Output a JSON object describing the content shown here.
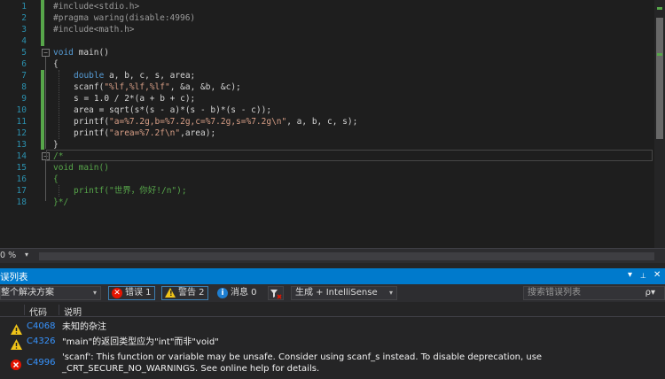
{
  "editor": {
    "line_numbers": [
      "1",
      "2",
      "3",
      "4",
      "5",
      "6",
      "7",
      "8",
      "9",
      "10",
      "11",
      "12",
      "13",
      "14",
      "15",
      "16",
      "17",
      "18"
    ]
  },
  "code": {
    "l1": "#include<stdio.h>",
    "l2": "#pragma waring(disable:4996)",
    "l3": "#include<math.h>",
    "l5_kw": "void",
    "l5_rest": " main()",
    "l6": "{",
    "l7_kw": "double",
    "l7_rest": " a, b, c, s, area;",
    "l8_a": "scanf(",
    "l8_str": "\"%lf,%lf,%lf\"",
    "l8_b": ", &a, &b, &c);",
    "l9": "s = 1.0 / 2*(a + b + c);",
    "l10": "area = sqrt(s*(s - a)*(s - b)*(s - c));",
    "l11_a": "printf(",
    "l11_str": "\"a=%7.2g,b=%7.2g,c=%7.2g,s=%7.2g\\n\"",
    "l11_b": ", a, b, c, s);",
    "l12_a": "printf(",
    "l12_str": "\"area=%7.2f\\n\"",
    "l12_b": ",area);",
    "l13": "}",
    "l14": "/*",
    "l15": "void main()",
    "l16": "{",
    "l17": "printf(\"世界，你好!/n\");",
    "l18": "}*/"
  },
  "zoom": {
    "value": "0 %"
  },
  "panel": {
    "title": "误列表",
    "title_icons": [
      "▾",
      "📌",
      "✕"
    ],
    "scope": "整个解决方案",
    "errors_label": "错误 1",
    "warnings_label": "警告 2",
    "messages_label": "消息 0",
    "build_label": "生成 + IntelliSense",
    "search_placeholder": "搜索错误列表",
    "search_icon": "ρ▾",
    "col_code": "代码",
    "col_desc": "说明",
    "rows": [
      {
        "severity": "warning",
        "code": "C4068",
        "desc": "未知的杂注"
      },
      {
        "severity": "warning",
        "code": "C4326",
        "desc": "\"main\"的返回类型应为\"int\"而非\"void\""
      },
      {
        "severity": "error",
        "code": "C4996",
        "desc": "'scanf': This function or variable may be unsafe. Consider using scanf_s instead. To disable deprecation, use _CRT_SECURE_NO_WARNINGS. See online help for details."
      }
    ]
  },
  "colors": {
    "accent": "#007acc",
    "keyword": "#569cd6",
    "string": "#d69d85",
    "comment": "#57a64a",
    "line_number": "#2b91af",
    "error": "#e51400",
    "warning": "#f0c419",
    "link": "#3794ff"
  },
  "icons": {
    "error": "error-circle-icon",
    "warning": "warning-triangle-icon",
    "info": "info-circle-icon",
    "filter": "filter-icon",
    "search": "search-icon"
  }
}
